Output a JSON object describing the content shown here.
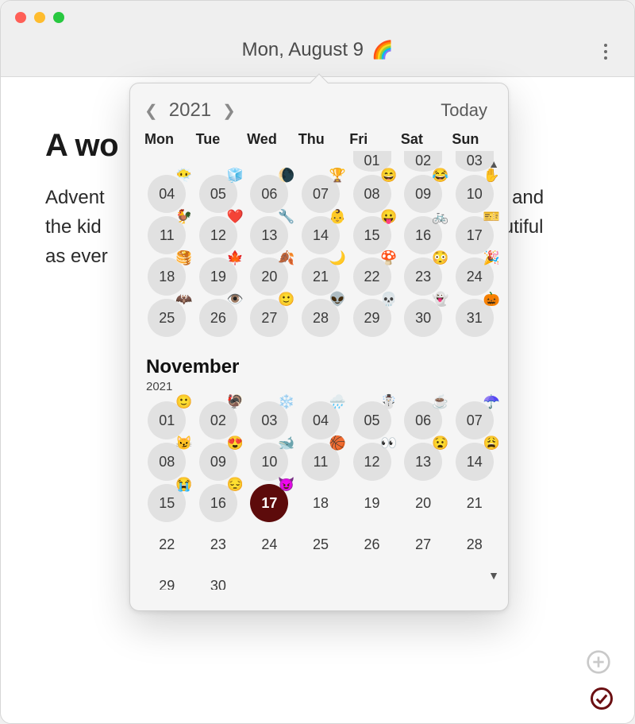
{
  "title": {
    "dateLabel": "Mon, August 9",
    "emoji": "🌈"
  },
  "entry": {
    "heading": "A wo",
    "bodyLine1": "Advent",
    "bodyMid1": "a and",
    "bodyLine2": "the kid",
    "bodyMid2": "eautiful",
    "bodyLine3": "as ever"
  },
  "calendar": {
    "year": "2021",
    "todayLabel": "Today",
    "dow": [
      "Mon",
      "Tue",
      "Wed",
      "Thu",
      "Fri",
      "Sat",
      "Sun"
    ],
    "topPartialRow": [
      {
        "num": "01"
      },
      {
        "num": "02"
      },
      {
        "num": "03"
      }
    ],
    "octoberWeeks": [
      [
        {
          "num": "04",
          "e": "😶‍🌫️"
        },
        {
          "num": "05",
          "e": "🧊"
        },
        {
          "num": "06",
          "e": "🌘"
        },
        {
          "num": "07",
          "e": "🏆"
        },
        {
          "num": "08",
          "e": "😄"
        },
        {
          "num": "09",
          "e": "😂"
        },
        {
          "num": "10",
          "e": "✋"
        }
      ],
      [
        {
          "num": "11",
          "e": "🐓"
        },
        {
          "num": "12",
          "e": "❤️"
        },
        {
          "num": "13",
          "e": "🔧"
        },
        {
          "num": "14",
          "e": "👶"
        },
        {
          "num": "15",
          "e": "😛"
        },
        {
          "num": "16",
          "e": "🚲"
        },
        {
          "num": "17",
          "e": "🎫"
        }
      ],
      [
        {
          "num": "18",
          "e": "🥞"
        },
        {
          "num": "19",
          "e": "🍁"
        },
        {
          "num": "20",
          "e": "🍂"
        },
        {
          "num": "21",
          "e": "🌙"
        },
        {
          "num": "22",
          "e": "🍄"
        },
        {
          "num": "23",
          "e": "😳"
        },
        {
          "num": "24",
          "e": "🎉"
        }
      ],
      [
        {
          "num": "25",
          "e": "🦇"
        },
        {
          "num": "26",
          "e": "👁️"
        },
        {
          "num": "27",
          "e": "🙂"
        },
        {
          "num": "28",
          "e": "👽"
        },
        {
          "num": "29",
          "e": "💀"
        },
        {
          "num": "30",
          "e": "👻"
        },
        {
          "num": "31",
          "e": "🎃"
        }
      ]
    ],
    "november": {
      "label": "November",
      "year": "2021",
      "weeks": [
        [
          {
            "num": "01",
            "e": "🙂"
          },
          {
            "num": "02",
            "e": "🦃"
          },
          {
            "num": "03",
            "e": "❄️"
          },
          {
            "num": "04",
            "e": "🌧️"
          },
          {
            "num": "05",
            "e": "☃️"
          },
          {
            "num": "06",
            "e": "☕"
          },
          {
            "num": "07",
            "e": "☂️"
          }
        ],
        [
          {
            "num": "08",
            "e": "😼"
          },
          {
            "num": "09",
            "e": "😍"
          },
          {
            "num": "10",
            "e": "🐋"
          },
          {
            "num": "11",
            "e": "🏀"
          },
          {
            "num": "12",
            "e": "👀"
          },
          {
            "num": "13",
            "e": "😧"
          },
          {
            "num": "14",
            "e": "😩"
          }
        ],
        [
          {
            "num": "15",
            "e": "😭"
          },
          {
            "num": "16",
            "e": "😔"
          },
          {
            "num": "17",
            "e": "😈",
            "sel": true
          },
          {
            "num": "18",
            "plain": true
          },
          {
            "num": "19",
            "plain": true
          },
          {
            "num": "20",
            "plain": true
          },
          {
            "num": "21",
            "plain": true
          }
        ],
        [
          {
            "num": "22",
            "plain": true
          },
          {
            "num": "23",
            "plain": true
          },
          {
            "num": "24",
            "plain": true
          },
          {
            "num": "25",
            "plain": true
          },
          {
            "num": "26",
            "plain": true
          },
          {
            "num": "27",
            "plain": true
          },
          {
            "num": "28",
            "plain": true
          }
        ],
        [
          {
            "num": "29",
            "plain": true
          },
          {
            "num": "30",
            "plain": true
          }
        ]
      ]
    }
  }
}
